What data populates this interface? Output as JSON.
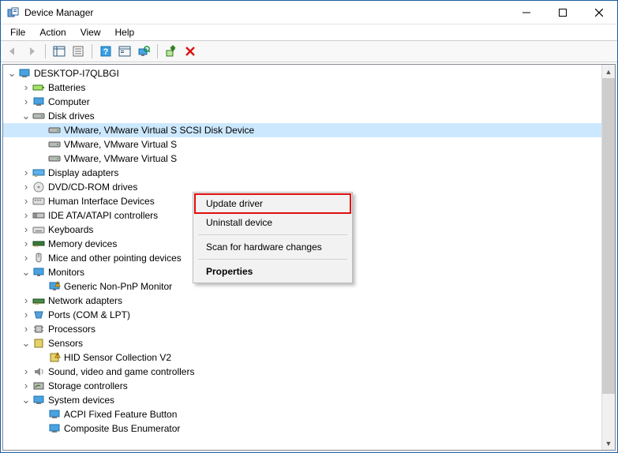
{
  "window": {
    "title": "Device Manager"
  },
  "menu": {
    "file": "File",
    "action": "Action",
    "view": "View",
    "help": "Help"
  },
  "tree": {
    "root": "DESKTOP-I7QLBGI",
    "batteries": "Batteries",
    "computer": "Computer",
    "disk_drives": "Disk drives",
    "disk_child": "VMware, VMware Virtual S SCSI Disk Device",
    "disk_child_cut": "VMware, VMware Virtual S",
    "display_adapters": "Display adapters",
    "dvd": "DVD/CD-ROM drives",
    "hid": "Human Interface Devices",
    "ide": "IDE ATA/ATAPI controllers",
    "keyboards": "Keyboards",
    "memory": "Memory devices",
    "mice": "Mice and other pointing devices",
    "monitors": "Monitors",
    "monitor_child": "Generic Non-PnP Monitor",
    "network": "Network adapters",
    "ports": "Ports (COM & LPT)",
    "processors": "Processors",
    "sensors": "Sensors",
    "sensor_child": "HID Sensor Collection V2",
    "sound": "Sound, video and game controllers",
    "storage": "Storage controllers",
    "system": "System devices",
    "sys_acpi": "ACPI Fixed Feature Button",
    "sys_composite": "Composite Bus Enumerator"
  },
  "context_menu": {
    "update_driver": "Update driver",
    "uninstall": "Uninstall device",
    "scan": "Scan for hardware changes",
    "properties": "Properties"
  }
}
